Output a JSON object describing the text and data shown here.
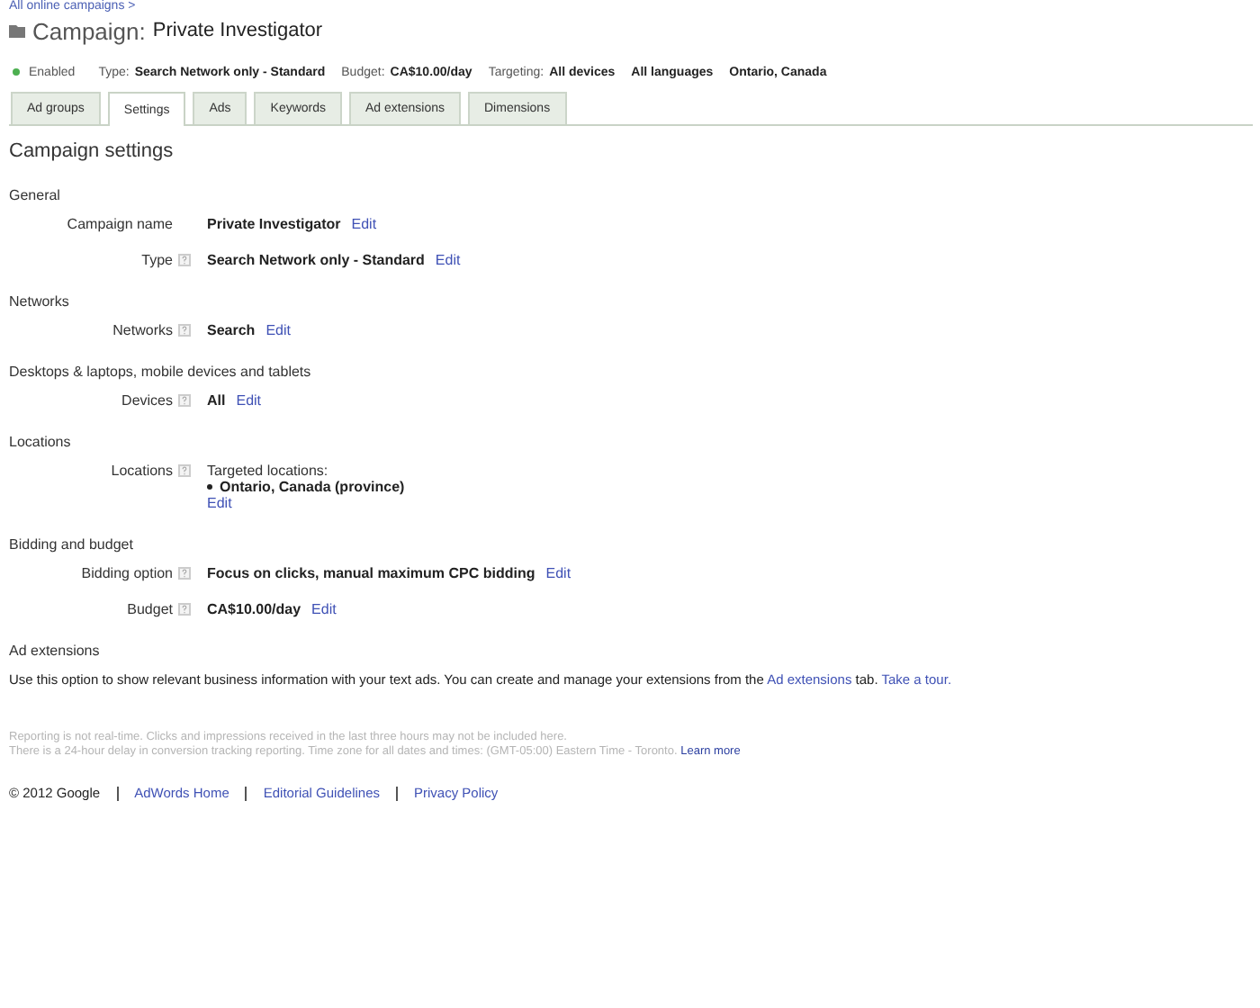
{
  "breadcrumb": "All online campaigns >",
  "title": {
    "prefix": "Campaign:",
    "name": "Private Investigator"
  },
  "status": {
    "label": "Enabled",
    "color": "#4caf50"
  },
  "summary": [
    {
      "label": "Type:",
      "value": "Search Network only - Standard"
    },
    {
      "label": "Budget:",
      "value": "CA$10.00/day"
    },
    {
      "label": "Targeting:",
      "value": "All devices"
    },
    {
      "value": "All languages"
    },
    {
      "value": "Ontario, Canada"
    }
  ],
  "tabs": [
    {
      "label": "Ad groups",
      "selected": false
    },
    {
      "label": "Settings",
      "selected": true
    },
    {
      "label": "Ads",
      "selected": false
    },
    {
      "label": "Keywords",
      "selected": false
    },
    {
      "label": "Ad extensions",
      "selected": false
    },
    {
      "label": "Dimensions",
      "selected": false
    }
  ],
  "heading": "Campaign settings",
  "sections": [
    {
      "title": "General",
      "rows": [
        {
          "label": "Campaign name",
          "help": false,
          "value": "Private Investigator",
          "edit": "Edit"
        },
        {
          "label": "Type",
          "help": true,
          "value": "Search Network only - Standard",
          "edit": "Edit"
        }
      ]
    },
    {
      "title": "Networks",
      "rows": [
        {
          "label": "Networks",
          "help": true,
          "value": "Search",
          "edit": "Edit"
        }
      ]
    },
    {
      "title": "Desktops & laptops, mobile devices and tablets",
      "rows": [
        {
          "label": "Devices",
          "help": true,
          "value": "All",
          "edit": "Edit"
        }
      ]
    },
    {
      "title": "Locations",
      "rows": [
        {
          "label": "Locations",
          "help": true,
          "value": "Targeted locations:",
          "items": [
            "Ontario, Canada (province)"
          ],
          "edit": "Edit"
        }
      ]
    },
    {
      "title": "Bidding and budget",
      "rows": [
        {
          "label": "Bidding option",
          "help": true,
          "value": "Focus on clicks, manual maximum CPC bidding",
          "edit": "Edit"
        },
        {
          "label": "Budget",
          "help": true,
          "value": "CA$10.00/day",
          "edit": "Edit"
        }
      ]
    },
    {
      "title": "Ad extensions",
      "description": [
        {
          "kind": "text",
          "text": "Use this option to show relevant business information with your text ads. You can create and manage your extensions from the "
        },
        {
          "kind": "link",
          "text": "Ad extensions"
        },
        {
          "kind": "text",
          "text": " tab. "
        },
        {
          "kind": "link",
          "text": "Take a tour."
        }
      ]
    }
  ],
  "notice": {
    "lines": [
      "Reporting is not real-time. Clicks and impressions received in the last three hours may not be included here.",
      "There is a 24-hour delay in conversion tracking reporting. Time zone for all dates and times: (GMT-05:00) Eastern Time - Toronto."
    ],
    "link": "Learn more"
  },
  "footer": {
    "copyright": "© 2012 Google",
    "links": [
      "AdWords Home",
      "Editorial Guidelines",
      "Privacy Policy"
    ]
  }
}
